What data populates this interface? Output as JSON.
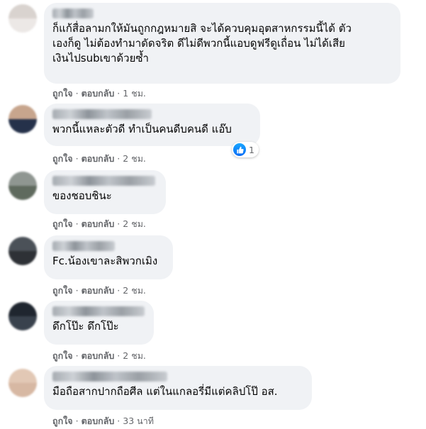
{
  "comments": [
    {
      "text": "ก็แก้สื่อลามกให้มันถูกกฎหมายสิ จะได้ควบคุมอุตสาหกรรมนี้ได้ ตัว\nเองก็ดู ไม่ต้องทำมาดัดจริต ดีไม่ดีพวกนี้แอบดูฟรีดูเถื่อน ไม่ได้เสีย\nเงินไปsubเขาด้วยซ้ำ",
      "like": "ถูกใจ",
      "reply": "ตอบกลับ",
      "time": "1 ชม."
    },
    {
      "text": "พวกนี้แหละตัวดี ทำเป็นคนดีบคนดี แอ๊บ",
      "like": "ถูกใจ",
      "reply": "ตอบกลับ",
      "time": "2 ชม.",
      "reaction_count": "1"
    },
    {
      "text": "ของชอบชินะ",
      "like": "ถูกใจ",
      "reply": "ตอบกลับ",
      "time": "2 ชม."
    },
    {
      "text": "Fc.น้องเขาละสิพวกเมิง",
      "like": "ถูกใจ",
      "reply": "ตอบกลับ",
      "time": "2 ชม."
    },
    {
      "text": "ดึกโป๊ะ ดึกโป๊ะ",
      "like": "ถูกใจ",
      "reply": "ตอบกลับ",
      "time": "2 ชม."
    },
    {
      "text": "มือถือสากปากถือศีล แต่ในแกลอรี่มีแต่คลิปโป๊ อส.",
      "like": "ถูกใจ",
      "reply": "ตอบกลับ",
      "time": "33 นาที"
    }
  ],
  "icons": {
    "reaction": "like-thumbs-up-icon"
  },
  "colors": {
    "bubble": "#f0f2f5",
    "meta": "#65676b",
    "like_blue": "#1877f2"
  }
}
